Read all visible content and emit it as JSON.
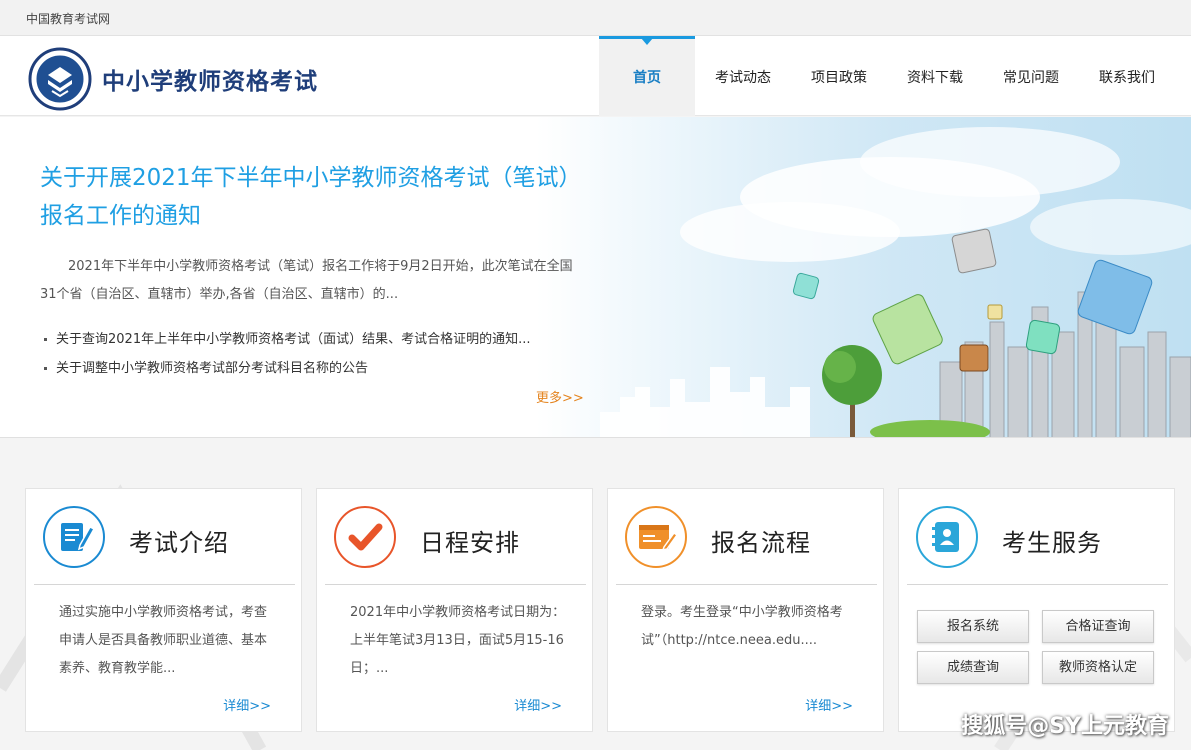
{
  "topbar": {
    "site_name": "中国教育考试网"
  },
  "header": {
    "brand": "中小学教师资格考试",
    "nav": [
      {
        "label": "首页",
        "active": true
      },
      {
        "label": "考试动态",
        "active": false
      },
      {
        "label": "项目政策",
        "active": false
      },
      {
        "label": "资料下载",
        "active": false
      },
      {
        "label": "常见问题",
        "active": false
      },
      {
        "label": "联系我们",
        "active": false
      }
    ]
  },
  "hero": {
    "title": "关于开展2021年下半年中小学教师资格考试（笔试）报名工作的通知",
    "desc": "2021年下半年中小学教师资格考试（笔试）报名工作将于9月2日开始，此次笔试在全国31个省（自治区、直辖市）举办,各省（自治区、直辖市）的...",
    "list": [
      "关于查询2021年上半年中小学教师资格考试（面试）结果、考试合格证明的通知...",
      "关于调整中小学教师资格考试部分考试科目名称的公告"
    ],
    "more": "更多>>"
  },
  "cards": [
    {
      "title": "考试介绍",
      "icon": "document-pencil-icon",
      "color": "#1a8ad2",
      "body": "通过实施中小学教师资格考试，考查申请人是否具备教师职业道德、基本素养、教育教学能...",
      "more": "详细>>"
    },
    {
      "title": "日程安排",
      "icon": "checkmark-icon",
      "color": "#e8552a",
      "body": "2021年中小学教师资格考试日期为：上半年笔试3月13日，面试5月15-16日；...",
      "more": "详细>>"
    },
    {
      "title": "报名流程",
      "icon": "form-pencil-icon",
      "color": "#f0902a",
      "body": "登录。考生登录“中小学教师资格考试”（http://ntce.neea.edu....",
      "more": "详细>>"
    },
    {
      "title": "考生服务",
      "icon": "contact-book-icon",
      "color": "#2aa6d9",
      "buttons": [
        "报名系统",
        "合格证查询",
        "成绩查询",
        "教师资格认定"
      ]
    }
  ],
  "watermark": "搜狐号@SY上元教育"
}
